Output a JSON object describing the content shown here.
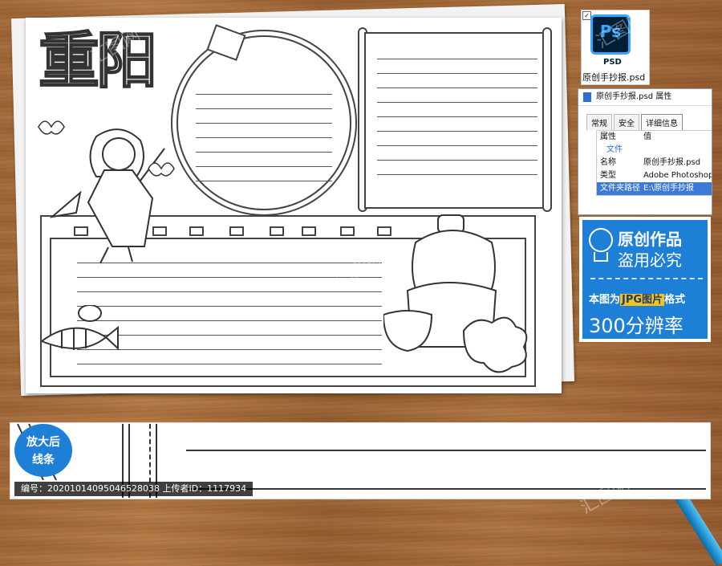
{
  "poster": {
    "title": "重阳"
  },
  "psd_file": {
    "icon_letters": "Ps",
    "icon_label": "PSD",
    "filename": "原创手抄报.psd",
    "checkbox": "✓"
  },
  "properties_dialog": {
    "title": "原创手抄报.psd 属性",
    "tabs": [
      "常规",
      "安全",
      "详细信息"
    ],
    "header": {
      "key": "属性",
      "value": "值"
    },
    "section": "文件",
    "rows": [
      {
        "key": "名称",
        "value": "原创手抄报.psd"
      },
      {
        "key": "类型",
        "value": "Adobe Photoshop"
      },
      {
        "key": "文件夹路径",
        "value": "E:\\原创手抄报"
      }
    ]
  },
  "promo": {
    "line1": "原创作品",
    "line2": "盗用必究",
    "line3_prefix": "本图为",
    "line3_highlight": "JPG图片",
    "line3_suffix": "格式",
    "line4": "300分辨率",
    "accent_color": "#1e7fd6",
    "highlight_color": "#f4c21d"
  },
  "badge": {
    "line1": "放大后",
    "line2": "线条"
  },
  "meta": {
    "text": "编号：20201014095046528038 上传者ID：1117934"
  },
  "watermark": {
    "text": "汇图网"
  }
}
